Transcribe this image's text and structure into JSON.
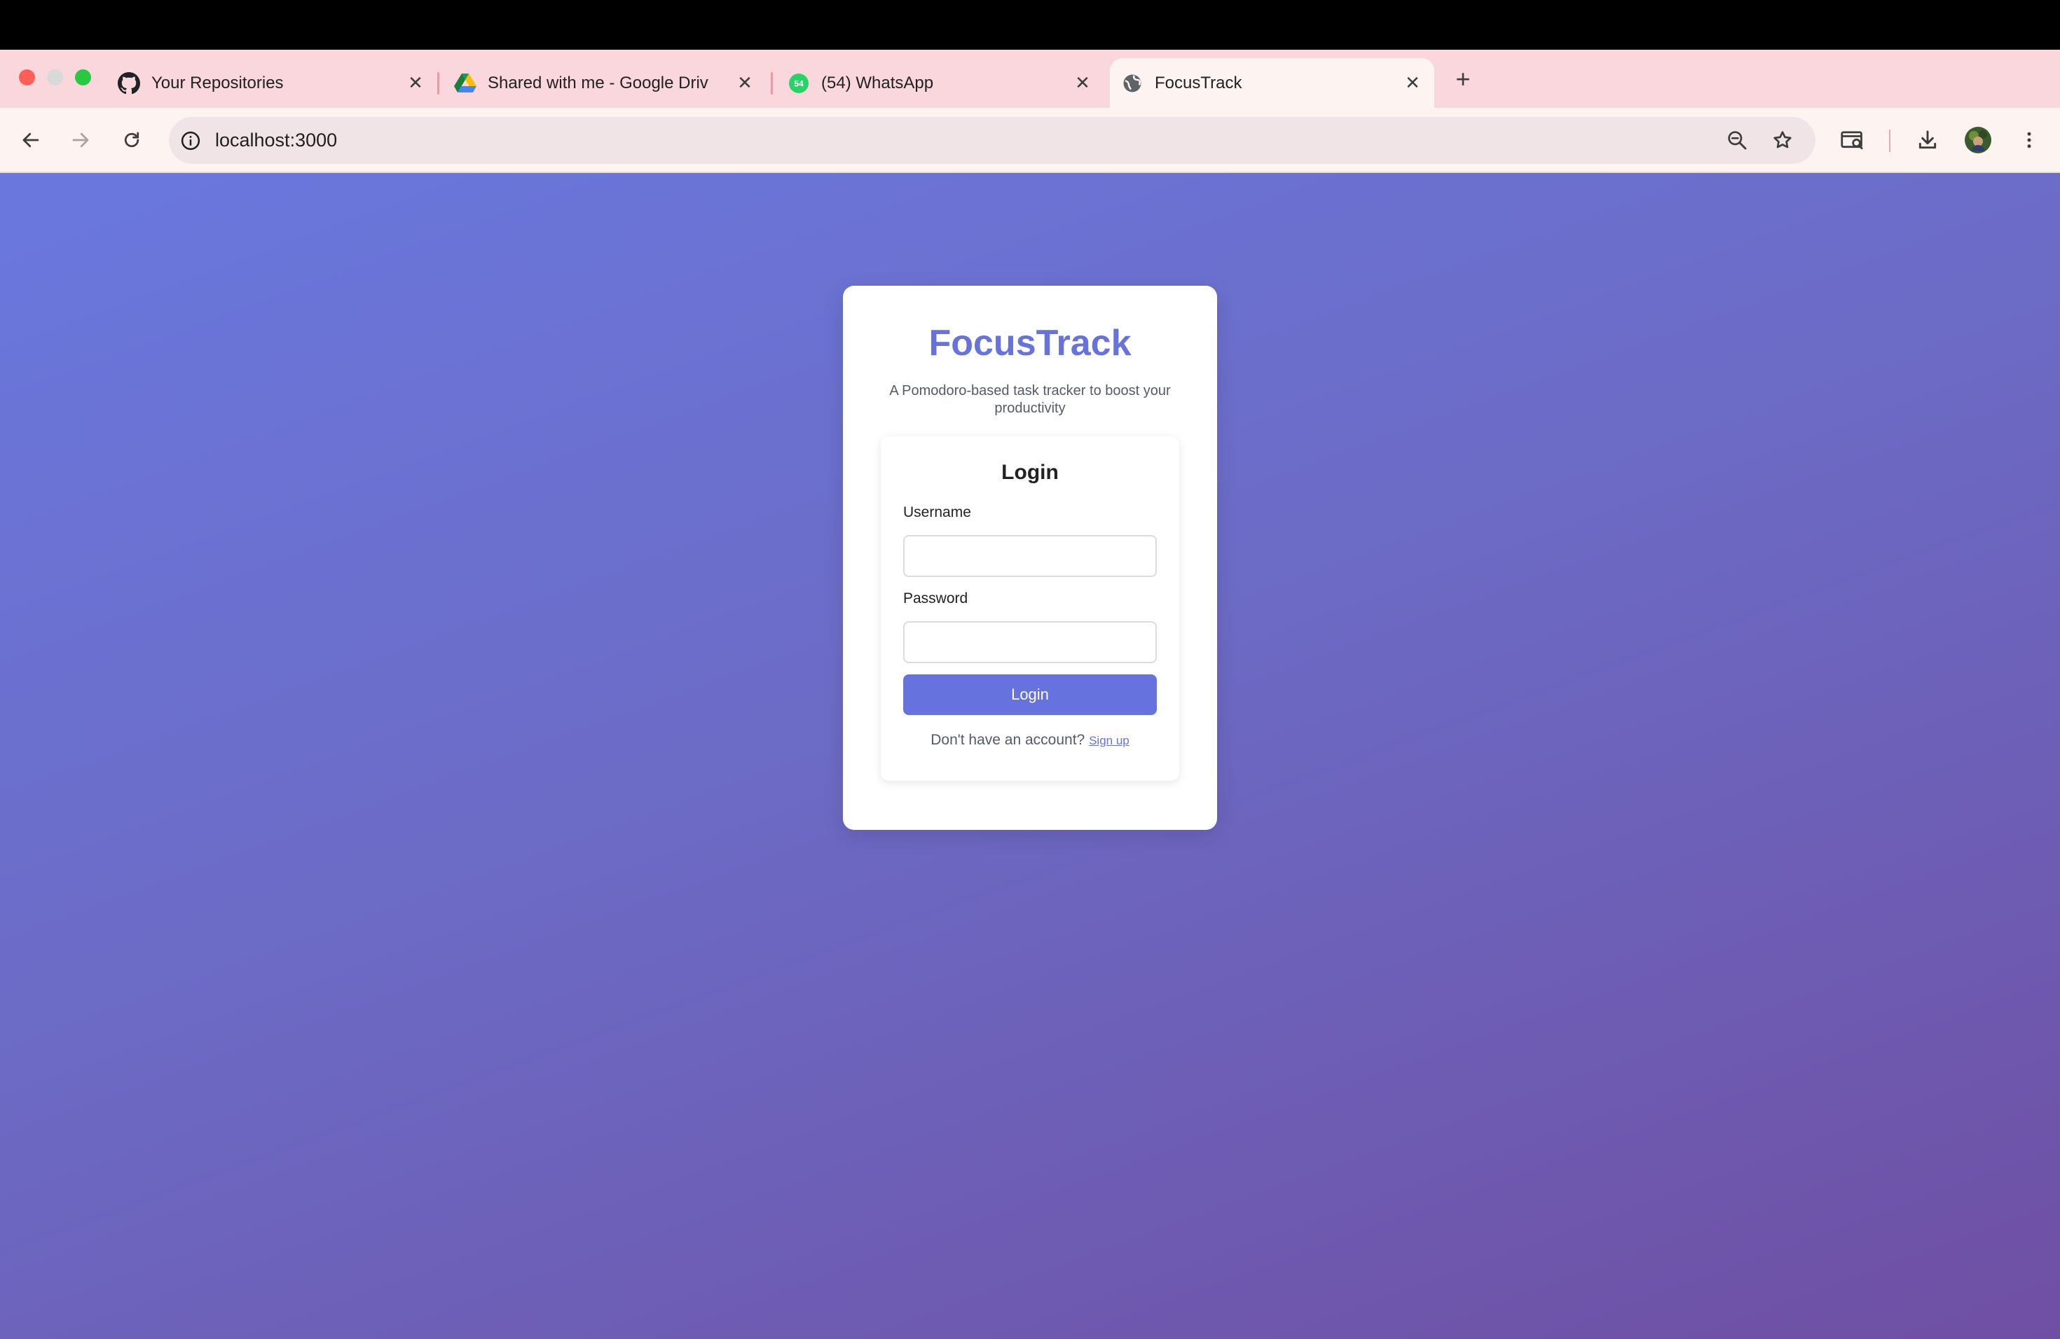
{
  "browser": {
    "tabs": [
      {
        "title": "Your Repositories",
        "icon": "github-icon",
        "active": false
      },
      {
        "title": "Shared with me - Google Driv",
        "icon": "google-drive-icon",
        "active": false
      },
      {
        "title": "(54) WhatsApp",
        "icon": "whatsapp-icon",
        "badge": "54",
        "active": false
      },
      {
        "title": "FocusTrack",
        "icon": "globe-icon",
        "active": true
      }
    ],
    "new_tab_label": "+",
    "close_label": "✕",
    "address": "localhost:3000"
  },
  "page": {
    "app_title": "FocusTrack",
    "tagline": "A Pomodoro-based task tracker to boost your productivity",
    "login": {
      "heading": "Login",
      "username_label": "Username",
      "username_value": "",
      "password_label": "Password",
      "password_value": "",
      "submit_label": "Login",
      "signup_prompt": "Don't have an account?",
      "signup_link": "Sign up"
    }
  },
  "colors": {
    "accent": "#6672de",
    "tabstrip": "#fad7dc",
    "gradient_start": "#6a78de",
    "gradient_end": "#6f4fa3"
  }
}
